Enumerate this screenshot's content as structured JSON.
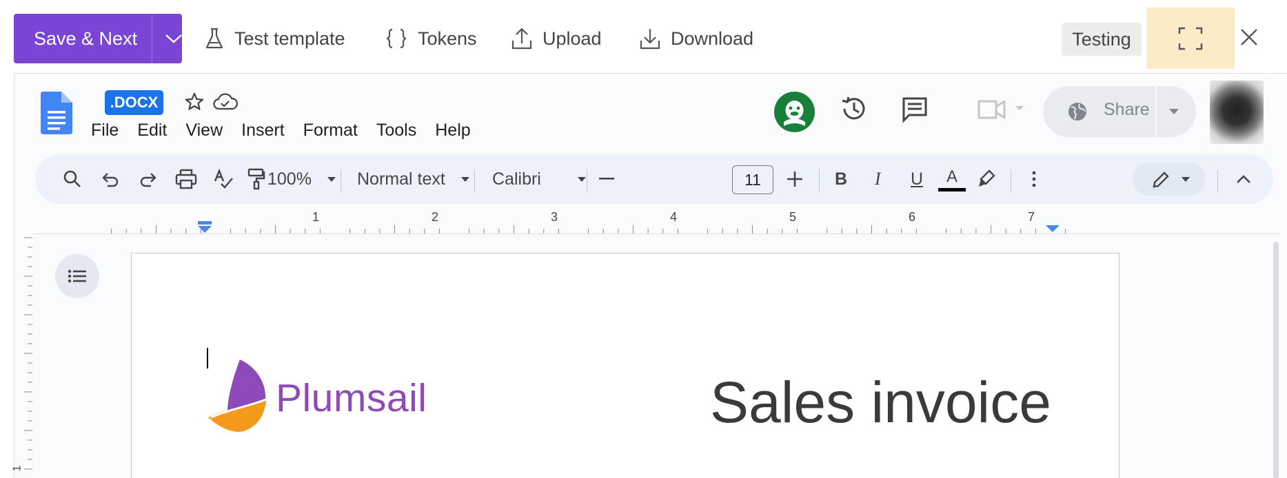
{
  "appbar": {
    "save_next_label": "Save & Next",
    "test_template_label": "Test template",
    "tokens_label": "Tokens",
    "upload_label": "Upload",
    "download_label": "Download",
    "testing_label": "Testing",
    "accent_color": "#7a45d4",
    "highlight_color": "#fbebc6"
  },
  "docs": {
    "file_badge": ".DOCX",
    "menu": [
      "File",
      "Edit",
      "View",
      "Insert",
      "Format",
      "Tools",
      "Help"
    ],
    "share_label": "Share",
    "toolbar": {
      "zoom": "100%",
      "style": "Normal text",
      "font": "Calibri",
      "font_size": "11",
      "bold": "B",
      "italic": "I",
      "underline": "U",
      "text_color": "A"
    },
    "ruler_numbers": [
      "1",
      "2",
      "3",
      "4",
      "5",
      "6",
      "7"
    ],
    "vertical_ruler_number": "1"
  },
  "document": {
    "logo_text": "Plumsail",
    "title": "Sales invoice"
  }
}
